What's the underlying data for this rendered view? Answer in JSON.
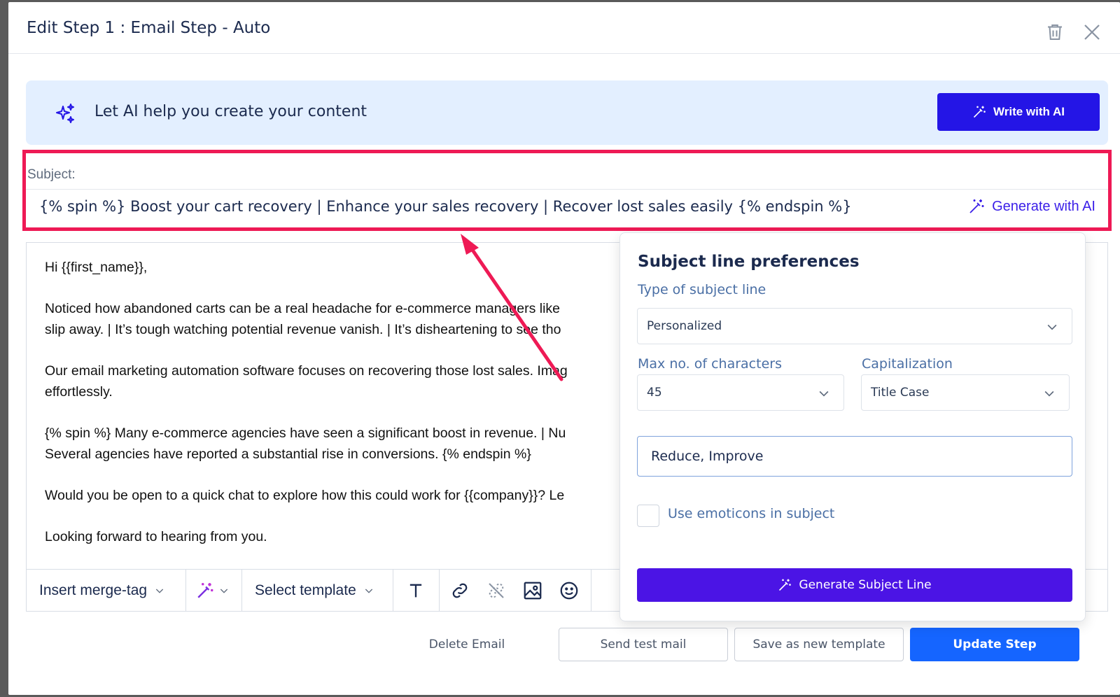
{
  "header": {
    "title": "Edit Step 1 : Email Step - Auto"
  },
  "ai_banner": {
    "text": "Let AI help you create your content",
    "button_label": "Write with AI"
  },
  "subject": {
    "label": "Subject:",
    "value": "{% spin %} Boost your cart recovery | Enhance your sales recovery | Recover lost sales easily {% endspin %}",
    "generate_label": "Generate with AI"
  },
  "editor": {
    "paragraphs": [
      "Hi {{first_name}},",
      "Noticed how abandoned carts can be a real headache for e-commerce managers like\nslip away. | It’s tough watching potential revenue vanish. | It’s disheartening to see tho",
      "Our email marketing automation software focuses on recovering those lost sales. Imag\neffortlessly.",
      "{% spin %} Many e-commerce agencies have seen a significant boost in revenue. | Nu\nSeveral agencies have reported a substantial rise in conversions. {% endspin %}",
      "Would you be open to a quick chat to explore how this could work for {{company}}? Le",
      "Looking forward to hearing from you."
    ],
    "toolbar": {
      "merge_tag_label": "Insert merge-tag",
      "template_label": "Select template"
    }
  },
  "preferences": {
    "title": "Subject line preferences",
    "type_label": "Type of subject line",
    "type_value": "Personalized",
    "max_chars_label": "Max no. of characters",
    "max_chars_value": "45",
    "capitalization_label": "Capitalization",
    "capitalization_value": "Title Case",
    "keywords_value": "Reduce, Improve",
    "emoticons_label": "Use emoticons in subject",
    "emoticons_checked": false,
    "generate_button": "Generate Subject Line"
  },
  "footer": {
    "delete_label": "Delete Email",
    "test_label": "Send test mail",
    "save_template_label": "Save as new template",
    "update_label": "Update Step"
  },
  "colors": {
    "accent": "#2415e6",
    "highlight": "#ee1a55",
    "primary": "#1565ff",
    "generate": "#4b14e5",
    "banner_bg": "#e3efff"
  }
}
